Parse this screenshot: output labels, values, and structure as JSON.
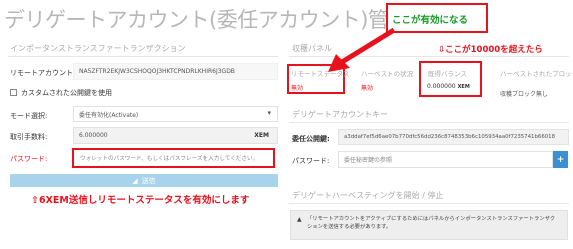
{
  "page_title": "デリゲートアカウント(委任アカウント)管理",
  "left": {
    "section_title": "インポータンストランスファートランザクション",
    "remote_account_label": "リモートアカウント:",
    "remote_account_value": "NA5ZFTR2EKJW3CSHOQOJ3HKTCPNDRLKHIR6J3GDB",
    "custom_key_label": "カスタムされた公開鍵を使用",
    "mode_label": "モード選択:",
    "mode_value": "委任有効化(Activate)",
    "fee_label": "取引手数料:",
    "fee_value": "6.000000",
    "fee_unit": "XEM",
    "password_label": "パスワード:",
    "password_placeholder": "ウォレットのパスワード、もしくはパスフレーズを入力してください。",
    "send_button": "送信"
  },
  "annotations": {
    "status_note": "ここが有効になる",
    "balance_note": "⇩ここが10000を超えたら",
    "send_note": "⇧6XEM送信しリモートステータスを有効にします"
  },
  "right": {
    "panel_title": "収穫パネル",
    "remote_status_label": "リモートステータス",
    "remote_status_value": "無効",
    "harvest_status_label": "ハーベストの状況",
    "harvest_status_value": "無効",
    "vested_label": "既得バランス",
    "vested_value": "0.000000",
    "vested_unit": "XEM",
    "harvested_blocks_label": "ハーベストされたブロック",
    "harvested_blocks_value": "収穫ブロック無し",
    "key_section_title": "デリゲートアカウントキー",
    "pubkey_label": "委任公開鍵:",
    "pubkey_value": "a3ddaf7ef5d6ae07b770dfc56dd236c8748353b6c105934aa0f7235741b66018",
    "key_password_label": "パスワード:",
    "key_password_placeholder": "委任秘密鍵の参照",
    "plus_label": "+",
    "harvest_section_title": "デリゲートハーベスティングを開始 / 停止",
    "harvest_notice": "「リモートアカウントをアクティブにするためにはパネルからインポータンストランスファートランザクションを送信する必要があります。"
  },
  "colors": {
    "annotation_red": "#e8121c",
    "annotation_green": "#1a9a2a",
    "button_blue": "#a9d3ec",
    "plus_blue": "#3b8fd5"
  }
}
